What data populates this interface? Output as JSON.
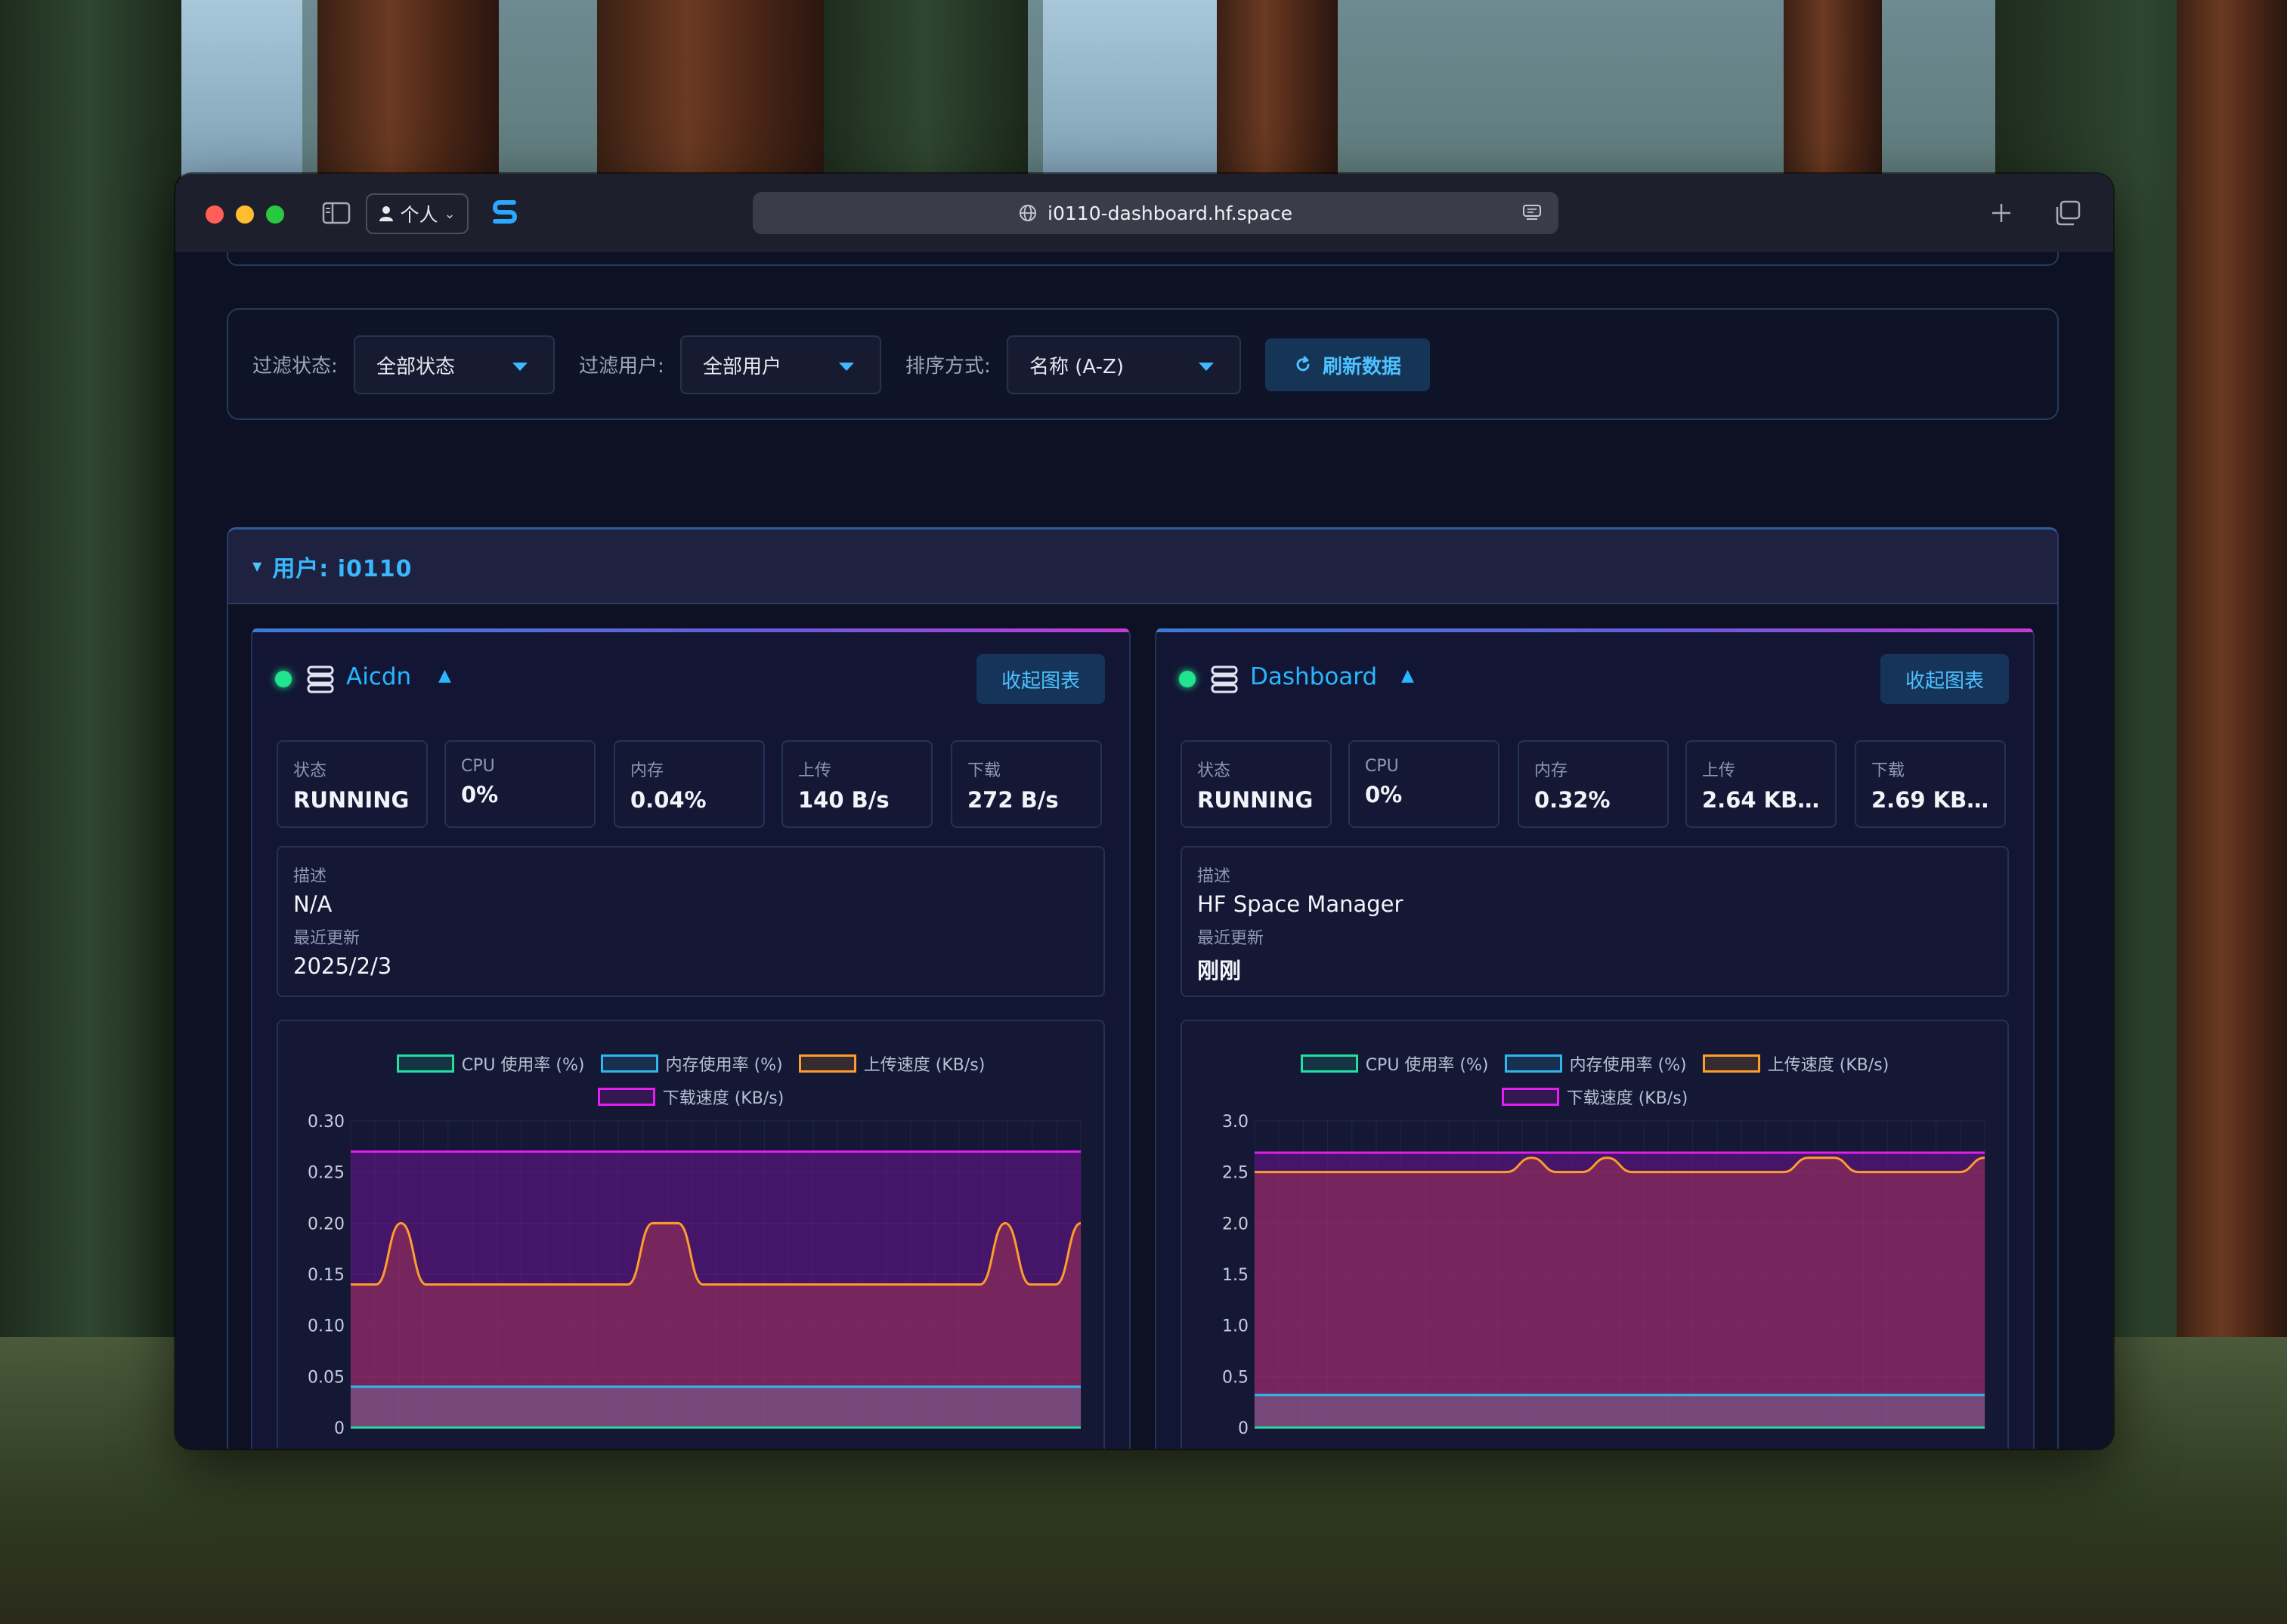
{
  "browser": {
    "profile_label": "个人",
    "url": "i0110-dashboard.hf.space"
  },
  "filters": {
    "status_label": "过滤状态:",
    "status_value": "全部状态",
    "user_label": "过滤用户:",
    "user_value": "全部用户",
    "sort_label": "排序方式:",
    "sort_value": "名称 (A-Z)",
    "refresh_label": "刷新数据"
  },
  "user_group": {
    "title": "用户: i0110"
  },
  "legend": [
    "CPU 使用率 (%)",
    "内存使用率 (%)",
    "上传速度 (KB/s)",
    "下载速度 (KB/s)"
  ],
  "colors": {
    "accent": "#27b6ff",
    "cpu": "#21e0a0",
    "memory": "#2fb6ea",
    "upload": "#ff9d2b",
    "download": "#e21ef0",
    "running_dot": "#21e48e"
  },
  "spaces": [
    {
      "name": "Aicdn",
      "collapse_label": "收起图表",
      "stats": [
        {
          "label": "状态",
          "value": "RUNNING"
        },
        {
          "label": "CPU",
          "value": "0%"
        },
        {
          "label": "内存",
          "value": "0.04%"
        },
        {
          "label": "上传",
          "value": "140 B/s"
        },
        {
          "label": "下载",
          "value": "272 B/s"
        }
      ],
      "desc_label": "描述",
      "desc_value": "N/A",
      "updated_label": "最近更新",
      "updated_value": "2025/2/3"
    },
    {
      "name": "Dashboard",
      "collapse_label": "收起图表",
      "stats": [
        {
          "label": "状态",
          "value": "RUNNING"
        },
        {
          "label": "CPU",
          "value": "0%"
        },
        {
          "label": "内存",
          "value": "0.32%"
        },
        {
          "label": "上传",
          "value": "2.64 KB/..."
        },
        {
          "label": "下载",
          "value": "2.69 KB..."
        }
      ],
      "desc_label": "描述",
      "desc_value": "HF Space Manager",
      "updated_label": "最近更新",
      "updated_value": "刚刚"
    }
  ],
  "chart_data": [
    {
      "type": "area",
      "yticks": [
        "0",
        "0.05",
        "0.10",
        "0.15",
        "0.20",
        "0.25",
        "0.30"
      ],
      "ylim": [
        0,
        0.3
      ],
      "grid": true,
      "legend_position": "top-center",
      "series": [
        {
          "name": "CPU 使用率 (%)",
          "values": [
            0,
            0,
            0,
            0,
            0,
            0,
            0,
            0,
            0,
            0,
            0,
            0,
            0,
            0,
            0,
            0,
            0,
            0,
            0,
            0,
            0,
            0,
            0,
            0,
            0,
            0,
            0,
            0,
            0,
            0
          ]
        },
        {
          "name": "内存使用率 (%)",
          "values": [
            0.04,
            0.04,
            0.04,
            0.04,
            0.04,
            0.04,
            0.04,
            0.04,
            0.04,
            0.04,
            0.04,
            0.04,
            0.04,
            0.04,
            0.04,
            0.04,
            0.04,
            0.04,
            0.04,
            0.04,
            0.04,
            0.04,
            0.04,
            0.04,
            0.04,
            0.04,
            0.04,
            0.04,
            0.04,
            0.04
          ]
        },
        {
          "name": "上传速度 (KB/s)",
          "values": [
            0.14,
            0.14,
            0.2,
            0.14,
            0.14,
            0.14,
            0.14,
            0.14,
            0.14,
            0.14,
            0.14,
            0.14,
            0.2,
            0.2,
            0.14,
            0.14,
            0.14,
            0.14,
            0.14,
            0.14,
            0.14,
            0.14,
            0.14,
            0.14,
            0.14,
            0.14,
            0.2,
            0.14,
            0.14,
            0.2
          ]
        },
        {
          "name": "下载速度 (KB/s)",
          "values": [
            0.27,
            0.27,
            0.27,
            0.27,
            0.27,
            0.27,
            0.27,
            0.27,
            0.27,
            0.27,
            0.27,
            0.27,
            0.27,
            0.27,
            0.27,
            0.27,
            0.27,
            0.27,
            0.27,
            0.27,
            0.27,
            0.27,
            0.27,
            0.27,
            0.27,
            0.27,
            0.27,
            0.27,
            0.27,
            0.27
          ]
        }
      ]
    },
    {
      "type": "area",
      "yticks": [
        "0",
        "0.5",
        "1.0",
        "1.5",
        "2.0",
        "2.5",
        "3.0"
      ],
      "ylim": [
        0,
        3.0
      ],
      "grid": true,
      "legend_position": "top-center",
      "series": [
        {
          "name": "CPU 使用率 (%)",
          "values": [
            0,
            0,
            0,
            0,
            0,
            0,
            0,
            0,
            0,
            0,
            0,
            0,
            0,
            0,
            0,
            0,
            0,
            0,
            0,
            0,
            0,
            0,
            0,
            0,
            0,
            0,
            0,
            0,
            0,
            0
          ]
        },
        {
          "name": "内存使用率 (%)",
          "values": [
            0.32,
            0.32,
            0.32,
            0.32,
            0.32,
            0.32,
            0.32,
            0.32,
            0.32,
            0.32,
            0.32,
            0.32,
            0.32,
            0.32,
            0.32,
            0.32,
            0.32,
            0.32,
            0.32,
            0.32,
            0.32,
            0.32,
            0.32,
            0.32,
            0.32,
            0.32,
            0.32,
            0.32,
            0.32,
            0.32
          ]
        },
        {
          "name": "上传速度 (KB/s)",
          "values": [
            2.5,
            2.5,
            2.5,
            2.5,
            2.5,
            2.5,
            2.5,
            2.5,
            2.5,
            2.5,
            2.5,
            2.64,
            2.5,
            2.5,
            2.64,
            2.5,
            2.5,
            2.5,
            2.5,
            2.5,
            2.5,
            2.5,
            2.64,
            2.64,
            2.5,
            2.5,
            2.5,
            2.5,
            2.5,
            2.64
          ]
        },
        {
          "name": "下载速度 (KB/s)",
          "values": [
            2.69,
            2.69,
            2.69,
            2.69,
            2.69,
            2.69,
            2.69,
            2.69,
            2.69,
            2.69,
            2.69,
            2.69,
            2.69,
            2.69,
            2.69,
            2.69,
            2.69,
            2.69,
            2.69,
            2.69,
            2.69,
            2.69,
            2.69,
            2.69,
            2.69,
            2.69,
            2.69,
            2.69,
            2.69,
            2.69
          ]
        }
      ]
    }
  ]
}
